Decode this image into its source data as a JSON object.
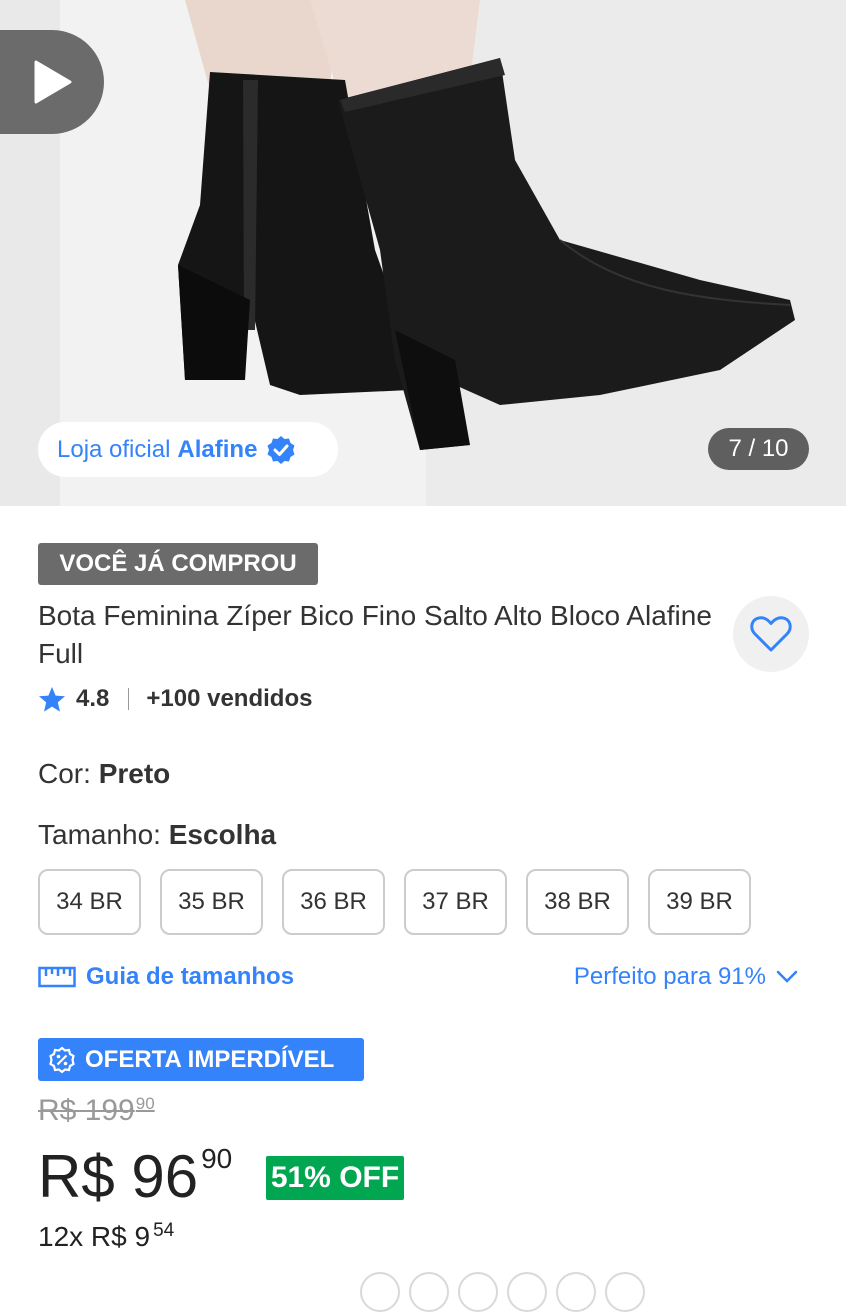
{
  "gallery": {
    "store_label": "Loja oficial",
    "store_name": "Alafine",
    "counter": "7 / 10",
    "play_icon": "play-icon",
    "verified_icon": "verified-badge-icon"
  },
  "product": {
    "purchased_badge": "VOCÊ JÁ COMPROU",
    "title": "Bota Feminina Zíper Bico Fino Salto Alto Bloco Alafine Full",
    "rating": "4.8",
    "sold": "+100 vendidos",
    "favorite_icon": "heart-icon"
  },
  "variations": {
    "color_label": "Cor: ",
    "color_value": "Preto",
    "size_label": "Tamanho: ",
    "size_value": "Escolha",
    "sizes": [
      "34 BR",
      "35 BR",
      "36 BR",
      "37 BR",
      "38 BR",
      "39 BR"
    ],
    "size_guide": "Guia de tamanhos",
    "fit_info": "Perfeito para 91%"
  },
  "pricing": {
    "deal_badge": "OFERTA IMPERDÍVEL",
    "old_price": "R$ 199",
    "old_price_cents": "90",
    "price": "R$ 96",
    "price_cents": "90",
    "discount": "51% OFF",
    "installments": "12x R$ 9",
    "installments_cents": "54"
  },
  "colors": {
    "accent_blue": "#3483fa",
    "discount_green": "#00a650",
    "badge_gray": "#6b6b6b"
  }
}
